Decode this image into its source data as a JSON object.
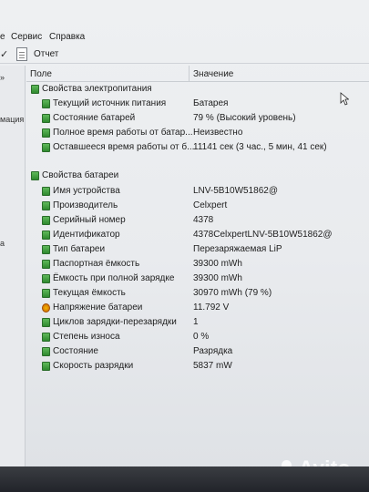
{
  "menu": {
    "items": [
      "e",
      "Сервис",
      "Справка"
    ]
  },
  "toolbar": {
    "report_label": "Отчет"
  },
  "left_panel": {
    "fragments": [
      "»",
      "мация",
      "а"
    ]
  },
  "columns": {
    "field": "Поле",
    "value": "Значение"
  },
  "sections": [
    {
      "title": "Свойства электропитания",
      "rows": [
        {
          "name": "Текущий источник питания",
          "value": "Батарея"
        },
        {
          "name": "Состояние батарей",
          "value": "79 % (Высокий уровень)"
        },
        {
          "name": "Полное время работы от батар...",
          "value": "Неизвестно"
        },
        {
          "name": "Оставшееся время работы от б...",
          "value": "11141 сек (3 час., 5 мин, 41 сек)"
        }
      ]
    },
    {
      "title": "Свойства батареи",
      "rows": [
        {
          "name": "Имя устройства",
          "value": "LNV-5B10W51862@"
        },
        {
          "name": "Производитель",
          "value": "Celxpert"
        },
        {
          "name": "Серийный номер",
          "value": "4378"
        },
        {
          "name": "Идентификатор",
          "value": "4378CelxpertLNV-5B10W51862@"
        },
        {
          "name": "Тип батареи",
          "value": "Перезаряжаемая LiP"
        },
        {
          "name": "Паспортная ёмкость",
          "value": "39300 mWh"
        },
        {
          "name": "Ёмкость при полной зарядке",
          "value": "39300 mWh"
        },
        {
          "name": "Текущая ёмкость",
          "value": "30970 mWh  (79 %)"
        },
        {
          "name": "Напряжение батареи",
          "value": "11.792 V",
          "icon": "warning-icon"
        },
        {
          "name": "Циклов зарядки-перезарядки",
          "value": "1"
        },
        {
          "name": "Степень износа",
          "value": "0 %"
        },
        {
          "name": "Состояние",
          "value": "Разрядка"
        },
        {
          "name": "Скорость разрядки",
          "value": "5837 mW"
        }
      ]
    }
  ],
  "watermark": {
    "text": "Avito"
  }
}
